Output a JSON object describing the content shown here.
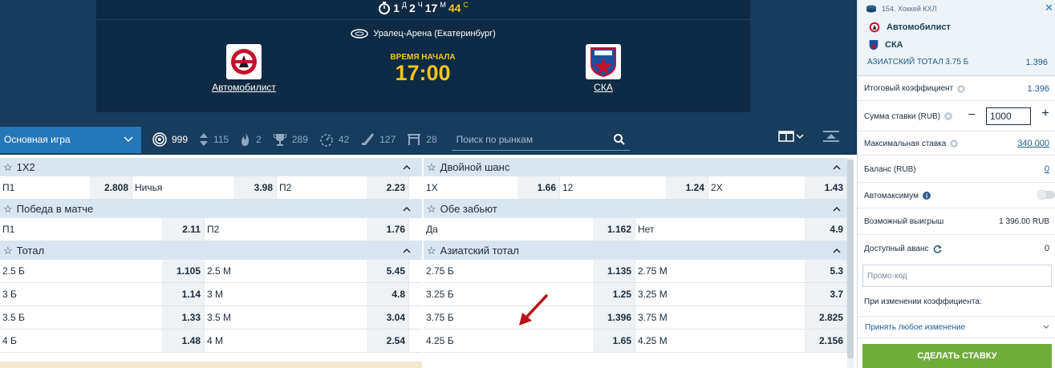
{
  "match": {
    "timer": {
      "days": "1",
      "days_unit": "Д",
      "hours": "2",
      "hours_unit": "Ч",
      "minutes": "17",
      "minutes_unit": "М",
      "seconds": "44",
      "seconds_unit": "С"
    },
    "venue": "Уралец-Арена (Екатеринбург)",
    "team1": "Автомобилист",
    "team2": "СКА",
    "start_label": "ВРЕМЯ НАЧАЛА",
    "start_time": "17:00"
  },
  "filters": {
    "main_game": "Основная игра",
    "items": [
      {
        "icon": "target-icon",
        "count": "999"
      },
      {
        "icon": "updown-arrows-icon",
        "count": "115"
      },
      {
        "icon": "flame-icon",
        "count": "2"
      },
      {
        "icon": "trophy-icon",
        "count": "289"
      },
      {
        "icon": "stopwatch-icon",
        "count": "42"
      },
      {
        "icon": "hockey-stick-icon",
        "count": "127"
      },
      {
        "icon": "gate-icon",
        "count": "28"
      }
    ],
    "search_placeholder": "Поиск по рынкам"
  },
  "markets_left": [
    {
      "title": "1X2",
      "rows": [
        [
          {
            "l": "П1",
            "o": "2.808"
          },
          {
            "l": "Ничья",
            "o": "3.98"
          },
          {
            "l": "П2",
            "o": "2.23"
          }
        ]
      ]
    },
    {
      "title": "Победа в матче",
      "rows": [
        [
          {
            "l": "П1",
            "o": "2.11"
          },
          {
            "l": "П2",
            "o": "1.76"
          }
        ]
      ]
    },
    {
      "title": "Тотал",
      "rows": [
        [
          {
            "l": "2.5 Б",
            "o": "1.105"
          },
          {
            "l": "2.5 М",
            "o": "5.45"
          }
        ],
        [
          {
            "l": "3 Б",
            "o": "1.14"
          },
          {
            "l": "3 М",
            "o": "4.8"
          }
        ],
        [
          {
            "l": "3.5 Б",
            "o": "1.33"
          },
          {
            "l": "3.5 М",
            "o": "3.04"
          }
        ],
        [
          {
            "l": "4 Б",
            "o": "1.48"
          },
          {
            "l": "4 М",
            "o": "2.54"
          }
        ]
      ]
    }
  ],
  "markets_right": [
    {
      "title": "Двойной шанс",
      "rows": [
        [
          {
            "l": "1X",
            "o": "1.66"
          },
          {
            "l": "12",
            "o": "1.24"
          },
          {
            "l": "2X",
            "o": "1.43"
          }
        ]
      ]
    },
    {
      "title": "Обе забьют",
      "rows": [
        [
          {
            "l": "Да",
            "o": "1.162"
          },
          {
            "l": "Нет",
            "o": "4.9"
          }
        ]
      ]
    },
    {
      "title": "Азиатский тотал",
      "rows": [
        [
          {
            "l": "2.75 Б",
            "o": "1.135"
          },
          {
            "l": "2.75 М",
            "o": "5.3"
          }
        ],
        [
          {
            "l": "3.25 Б",
            "o": "1.25"
          },
          {
            "l": "3.25 М",
            "o": "3.7"
          }
        ],
        [
          {
            "l": "3.75 Б",
            "o": "1.396"
          },
          {
            "l": "3.75 М",
            "o": "2.825"
          }
        ],
        [
          {
            "l": "4.25 Б",
            "o": "1.65"
          },
          {
            "l": "4.25 М",
            "o": "2.156"
          }
        ]
      ]
    }
  ],
  "slip": {
    "league": "154. Хоккей КХЛ",
    "team1": "Автомобилист",
    "team2": "СКА",
    "market": "АЗИАТСКИЙ ТОТАЛ 3.75 Б",
    "odd": "1.396",
    "total_coef_label": "Итоговый коэффициент",
    "total_coef": "1.396",
    "stake_label": "Сумма ставки (RUB)",
    "stake_value": "1000",
    "minus": "−",
    "plus": "+",
    "max_stake_label": "Максимальная ставка",
    "max_stake": "340 000",
    "balance_label": "Баланс (RUB)",
    "balance": "0",
    "automax_label": "Автомаксимум",
    "possible_win_label": "Возможный выигрыш",
    "possible_win": "1 396.00 RUB",
    "advance_label": "Доступный аванс",
    "advance": "0",
    "promo_placeholder": "Промо-код",
    "on_change_label": "При изменении коэффициента:",
    "accept_option": "Принять любое изменение",
    "make_bet": "СДЕЛАТЬ СТАВКУ"
  },
  "colors": {
    "brand": "#173c5c",
    "accent": "#2677b8",
    "gold": "#f5c518",
    "bet_button": "#6fae3c",
    "arrow": "#b5121b"
  }
}
